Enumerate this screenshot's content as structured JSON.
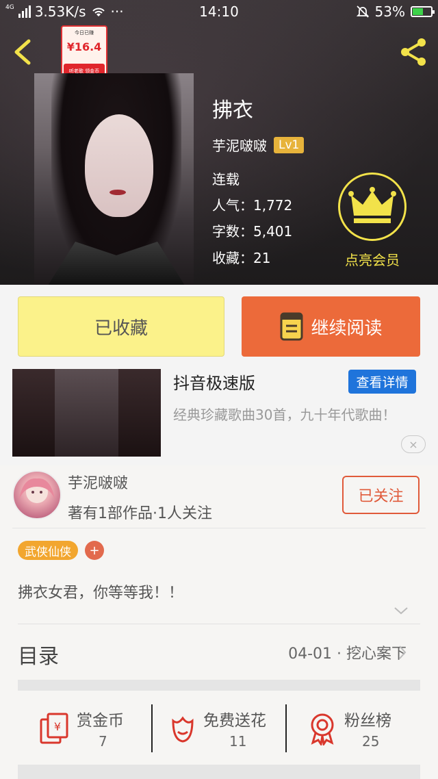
{
  "status_bar": {
    "network_type": "4G",
    "speed": "3.53K/s",
    "dots": "···",
    "time": "14:10",
    "battery": "53%",
    "battery_level": 0.53
  },
  "book": {
    "title": "拂衣",
    "author": "芋泥啵啵",
    "level": "Lv1",
    "status": "连载",
    "popularity_label": "人气：",
    "popularity": "1,772",
    "words_label": "字数：",
    "words": "5,401",
    "favorites_label": "收藏：",
    "favorites": "21"
  },
  "vip": {
    "label": "点亮会员",
    "color": "#f2e24a"
  },
  "actions": {
    "favorited_label": "已收藏",
    "continue_label": "继续阅读"
  },
  "ad": {
    "app_name": "抖音极速版",
    "detail_button": "查看详情",
    "description": "经典珍藏歌曲30首，九十年代歌曲！",
    "card_top_text": "今日已赚",
    "card_amount": "¥16.4",
    "card_bottom_text": "听老歌  领金币",
    "close_icon": "×"
  },
  "author_card": {
    "name": "芋泥啵啵",
    "works_text": "著有1部作品·1人关注",
    "follow_label": "已关注"
  },
  "tags": {
    "items": [
      "武侠仙侠"
    ],
    "add": "+"
  },
  "summary": "拂衣女君，你等等我！！",
  "toc": {
    "label": "目录",
    "latest": "04-01 · 挖心案下"
  },
  "stats": [
    {
      "label": "赏金币",
      "value": "7",
      "icon": "coin-envelope-icon"
    },
    {
      "label": "免费送花",
      "value": "11",
      "icon": "flower-icon"
    },
    {
      "label": "粉丝榜",
      "value": "25",
      "icon": "medal-icon"
    }
  ],
  "colors": {
    "accent_orange": "#ec6a3a",
    "fav_yellow": "#fbf28a",
    "ad_blue": "#1f74db",
    "tag_orange": "#f2a62f",
    "icon_red": "#d9372c"
  }
}
